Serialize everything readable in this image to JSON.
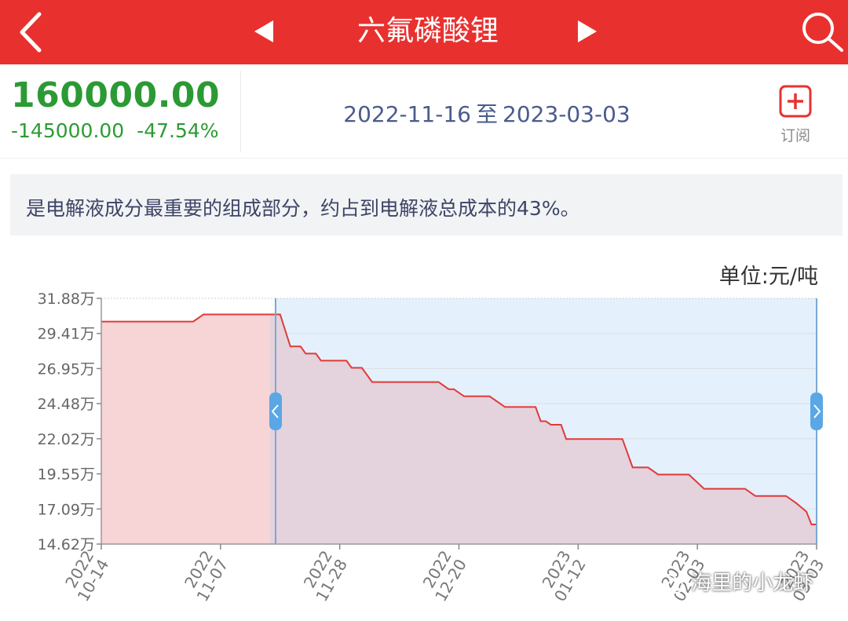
{
  "header": {
    "title": "六氟磷酸锂",
    "back_icon": "chevron-left-icon",
    "prev_icon": "triangle-left-icon",
    "next_icon": "triangle-right-icon",
    "search_icon": "search-icon"
  },
  "summary": {
    "price": "160000.00",
    "change": "-145000.00",
    "change_pct": "-47.54%",
    "date_start": "2022-11-16",
    "date_sep": "至",
    "date_end": "2023-03-03",
    "subscribe_label": "订阅",
    "price_color": "#2c9a34"
  },
  "description": "是电解液成分最重要的组成部分，约占到电解液总成本的43%。",
  "unit_label": "单位:元/吨",
  "watermark": "海里的小龙虾",
  "colors": {
    "brand": "#e8312f",
    "line": "#e03a3a",
    "selected_bg": "#e4f1fc",
    "handle": "#5aa7e6"
  },
  "chart_data": {
    "type": "area",
    "y_ticks": [
      "31.88万",
      "29.41万",
      "26.95万",
      "24.48万",
      "22.02万",
      "19.55万",
      "17.09万",
      "14.62万"
    ],
    "x_ticks": [
      {
        "year": "2022",
        "md": "10-14"
      },
      {
        "year": "2022",
        "md": "11-07"
      },
      {
        "year": "2022",
        "md": "11-28"
      },
      {
        "year": "2022",
        "md": "12-20"
      },
      {
        "year": "2023",
        "md": "01-12"
      },
      {
        "year": "2023",
        "md": "02-03"
      },
      {
        "year": "2023",
        "md": "03-03"
      }
    ],
    "ylim": [
      14.62,
      31.88
    ],
    "xlim": [
      "2022-10-14",
      "2023-03-03"
    ],
    "selected_range": [
      "2022-11-16",
      "2023-03-03"
    ],
    "y_unit": "万元/吨",
    "series": [
      {
        "points": [
          [
            "2022-10-14",
            30.25
          ],
          [
            "2022-11-01",
            30.25
          ],
          [
            "2022-11-03",
            30.75
          ],
          [
            "2022-11-18",
            30.75
          ],
          [
            "2022-11-20",
            28.5
          ],
          [
            "2022-11-22",
            28.5
          ],
          [
            "2022-11-23",
            28.0
          ],
          [
            "2022-11-25",
            28.0
          ],
          [
            "2022-11-26",
            27.5
          ],
          [
            "2022-12-01",
            27.5
          ],
          [
            "2022-12-02",
            27.0
          ],
          [
            "2022-12-04",
            27.0
          ],
          [
            "2022-12-06",
            26.0
          ],
          [
            "2022-12-19",
            26.0
          ],
          [
            "2022-12-21",
            25.5
          ],
          [
            "2022-12-22",
            25.5
          ],
          [
            "2022-12-24",
            25.0
          ],
          [
            "2022-12-29",
            25.0
          ],
          [
            "2022-12-31",
            24.5
          ],
          [
            "2023-01-01",
            24.25
          ],
          [
            "2023-01-07",
            24.25
          ],
          [
            "2023-01-08",
            23.25
          ],
          [
            "2023-01-09",
            23.25
          ],
          [
            "2023-01-10",
            23.0
          ],
          [
            "2023-01-12",
            23.0
          ],
          [
            "2023-01-13",
            22.0
          ],
          [
            "2023-01-24",
            22.0
          ],
          [
            "2023-01-26",
            20.0
          ],
          [
            "2023-01-29",
            20.0
          ],
          [
            "2023-01-31",
            19.5
          ],
          [
            "2023-02-06",
            19.5
          ],
          [
            "2023-02-09",
            18.5
          ],
          [
            "2023-02-17",
            18.5
          ],
          [
            "2023-02-19",
            18.0
          ],
          [
            "2023-02-25",
            18.0
          ],
          [
            "2023-02-27",
            17.5
          ],
          [
            "2023-03-01",
            16.9
          ],
          [
            "2023-03-02",
            16.0
          ],
          [
            "2023-03-03",
            16.0
          ]
        ]
      }
    ]
  }
}
